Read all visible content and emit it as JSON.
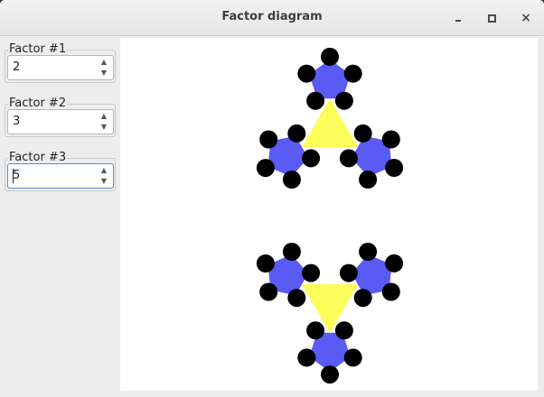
{
  "window": {
    "title": "Factor diagram"
  },
  "factors": [
    {
      "legend": "Factor #1",
      "value": "2"
    },
    {
      "legend": "Factor #2",
      "value": "3"
    },
    {
      "legend": "Factor #3",
      "value": "5"
    }
  ],
  "icons": {
    "up": "▲",
    "down": "▼",
    "close": "×"
  },
  "colors": {
    "inner": "#fdfd5c",
    "middle": "#5a5af5",
    "outer": "#000000",
    "canvas": "#ffffff"
  }
}
